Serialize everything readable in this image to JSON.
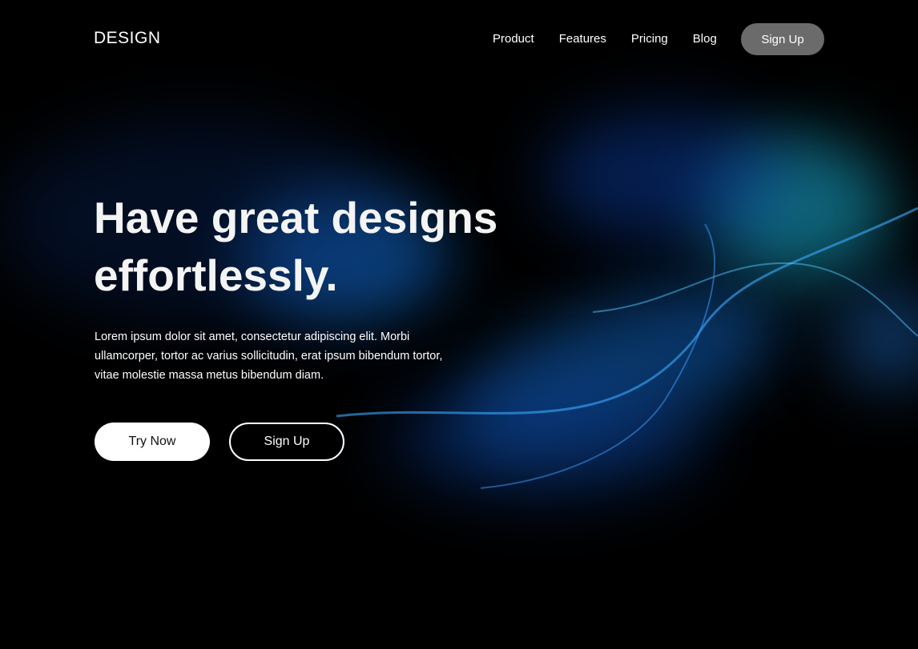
{
  "nav": {
    "logo": "DESIGN",
    "links": [
      "Product",
      "Features",
      "Pricing",
      "Blog"
    ],
    "signup": "Sign Up"
  },
  "hero": {
    "title": "Have great designs effortlessly.",
    "description": "Lorem ipsum dolor sit amet, consectetur adipiscing elit. Morbi ullamcorper, tortor ac varius sollicitudin, erat ipsum bibendum tortor, vitae molestie massa metus bibendum diam.",
    "try_now": "Try Now",
    "sign_up": "Sign Up"
  },
  "colors": {
    "background": "#000000",
    "accent": "#1ec8f0",
    "nav_button": "#6b6b6b"
  }
}
